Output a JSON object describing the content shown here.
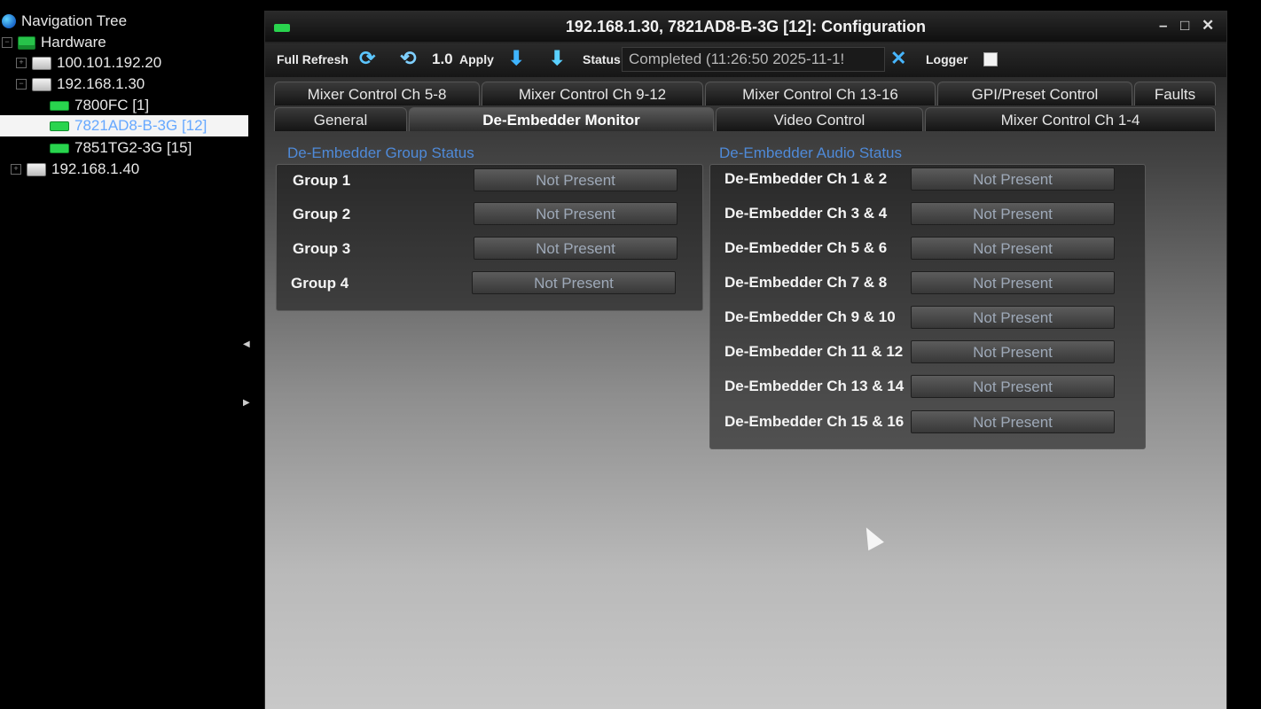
{
  "nav": {
    "title": "Navigation Tree",
    "hardware": "Hardware",
    "nodes": [
      {
        "label": "100.101.192.20"
      },
      {
        "label": "192.168.1.30"
      },
      {
        "label": "7800FC  [1]"
      },
      {
        "label": "7821AD8-B-3G  [12]"
      },
      {
        "label": "7851TG2-3G  [15]"
      },
      {
        "label": "192.168.1.40"
      }
    ]
  },
  "window": {
    "title": "192.168.1.30, 7821AD8-B-3G  [12]: Configuration",
    "controls": {
      "minimize": "–",
      "maximize": "□",
      "close": "✕"
    }
  },
  "toolbar": {
    "full_refresh": "Full Refresh",
    "refresh_value": "1.0",
    "apply": "Apply",
    "status_label": "Status",
    "status_value": "Completed  (11:26:50  2025-11-1!",
    "logger": "Logger"
  },
  "tabs": {
    "row1": [
      {
        "label": "Mixer Control Ch 5-8"
      },
      {
        "label": "Mixer Control Ch 9-12"
      },
      {
        "label": "Mixer Control Ch 13-16"
      },
      {
        "label": "GPI/Preset Control"
      },
      {
        "label": "Faults"
      }
    ],
    "row2": [
      {
        "label": "General"
      },
      {
        "label": "De-Embedder Monitor"
      },
      {
        "label": "Video Control"
      },
      {
        "label": "Mixer Control Ch 1-4"
      }
    ]
  },
  "group_status": {
    "title": "De-Embedder Group Status",
    "rows": [
      {
        "label": "Group 1",
        "value": "Not Present"
      },
      {
        "label": "Group 2",
        "value": "Not Present"
      },
      {
        "label": "Group 3",
        "value": "Not Present"
      },
      {
        "label": "Group 4",
        "value": "Not Present"
      }
    ]
  },
  "audio_status": {
    "title": "De-Embedder Audio Status",
    "rows": [
      {
        "label": "De-Embedder Ch 1 & 2",
        "value": "Not Present"
      },
      {
        "label": "De-Embedder Ch 3 & 4",
        "value": "Not Present"
      },
      {
        "label": "De-Embedder Ch 5 & 6",
        "value": "Not Present"
      },
      {
        "label": "De-Embedder Ch 7 & 8",
        "value": "Not Present"
      },
      {
        "label": "De-Embedder Ch 9 & 10",
        "value": "Not Present"
      },
      {
        "label": "De-Embedder Ch 11 & 12",
        "value": "Not Present"
      },
      {
        "label": "De-Embedder Ch 13 & 14",
        "value": "Not Present"
      },
      {
        "label": "De-Embedder Ch 15 & 16",
        "value": "Not Present"
      }
    ]
  }
}
